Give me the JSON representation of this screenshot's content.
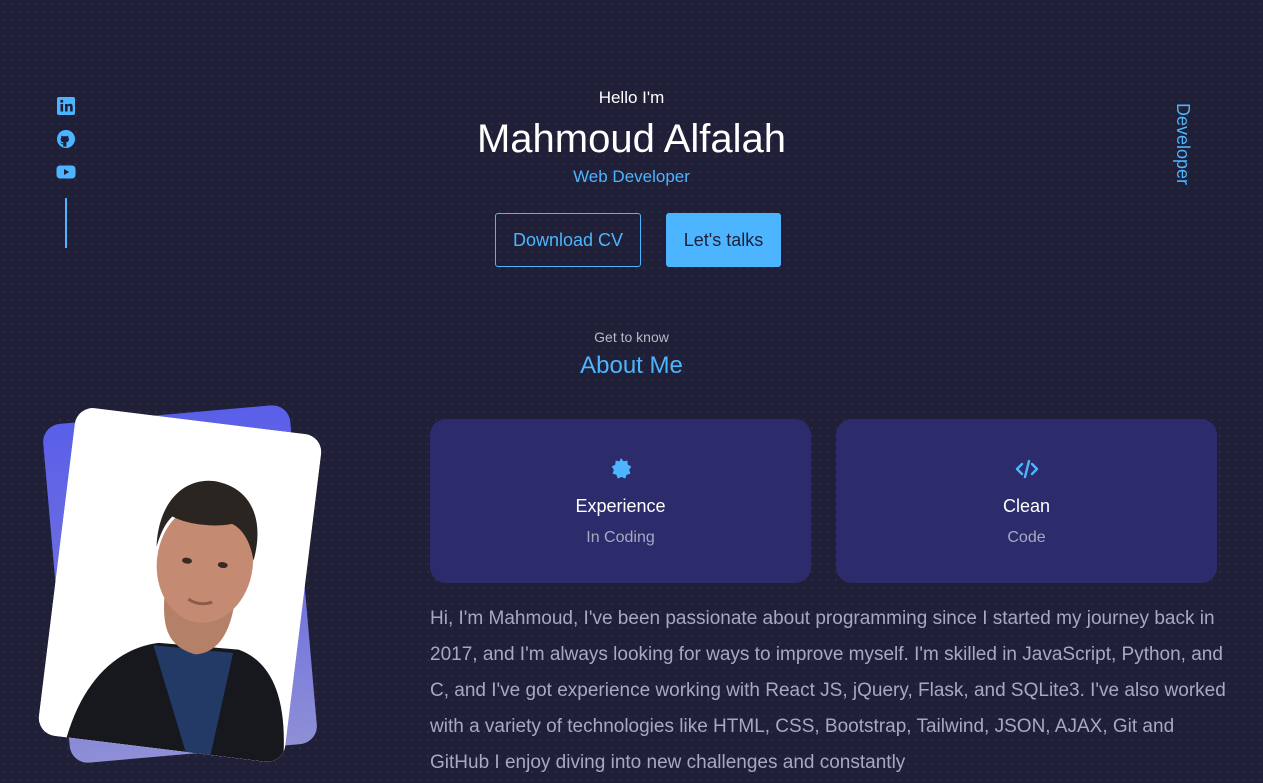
{
  "header": {
    "greeting": "Hello I'm",
    "name": "Mahmoud Alfalah",
    "role": "Web Developer",
    "download_cv_label": "Download CV",
    "lets_talk_label": "Let's talks",
    "side_label": "Developer"
  },
  "socials": [
    {
      "icon": "linkedin-icon"
    },
    {
      "icon": "github-icon"
    },
    {
      "icon": "youtube-icon"
    }
  ],
  "about": {
    "subtitle": "Get to know",
    "title": "About Me",
    "cards": [
      {
        "icon": "award-icon",
        "title": "Experience",
        "subtitle": "In Coding"
      },
      {
        "icon": "code-icon",
        "title": "Clean",
        "subtitle": "Code"
      }
    ],
    "bio": "Hi, I'm Mahmoud, I've been passionate about programming since I started my journey back in 2017, and I'm always looking for ways to improve myself. I'm skilled in JavaScript, Python, and C, and I've got experience working with React JS, jQuery, Flask, and SQLite3. I've also worked with a variety of technologies like HTML, CSS, Bootstrap, Tailwind, JSON, AJAX, Git and GitHub I enjoy diving into new challenges and constantly"
  },
  "colors": {
    "background": "#1f1f38",
    "primary": "#4db5ff",
    "card": "#2c2c6c",
    "muted_text": "#a8a8c0"
  }
}
